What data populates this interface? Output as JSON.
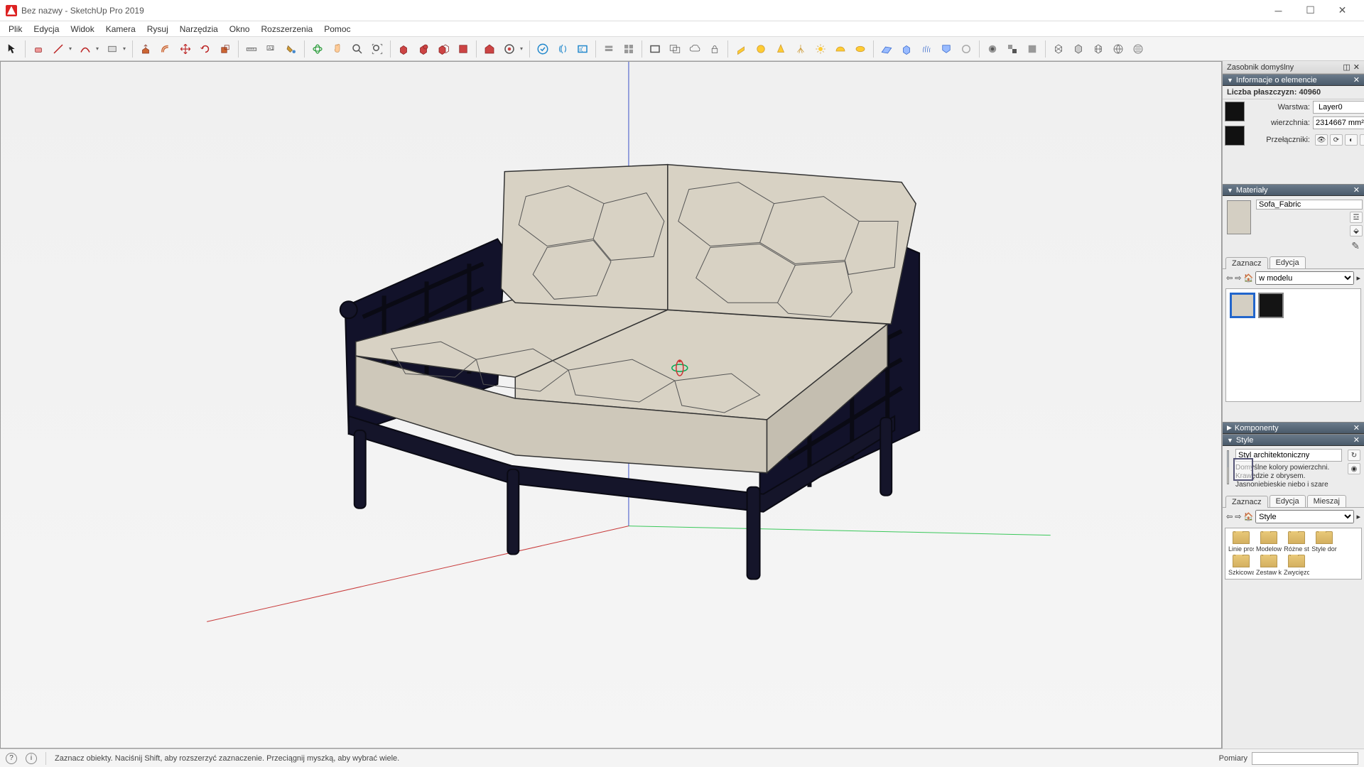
{
  "window": {
    "title": "Bez nazwy - SketchUp Pro 2019"
  },
  "menu": {
    "items": [
      "Plik",
      "Edycja",
      "Widok",
      "Kamera",
      "Rysuj",
      "Narzędzia",
      "Okno",
      "Rozszerzenia",
      "Pomoc"
    ]
  },
  "tray": {
    "title": "Zasobnik domyślny",
    "entity_info": {
      "title": "Informacje o elemencie",
      "faces_label": "Liczba płaszczyzn:",
      "faces_value": "40960",
      "layer_label": "Warstwa:",
      "layer_value": "Layer0",
      "area_label": "wierzchnia:",
      "area_value": "2314667 mm²",
      "toggles_label": "Przełączniki:"
    },
    "materials": {
      "title": "Materiały",
      "name": "Sofa_Fabric",
      "tab_select": "Zaznacz",
      "tab_edit": "Edycja",
      "scope": "w modelu",
      "swatches": [
        {
          "color": "#d4cfc3",
          "selected": true
        },
        {
          "color": "#141414",
          "selected": false
        }
      ]
    },
    "components": {
      "title": "Komponenty"
    },
    "styles": {
      "title": "Style",
      "name": "Styl architektoniczny",
      "desc": "Domyślne kolory powierzchni. Krawędzie z obrysem. Jasnoniebieskie niebo i szare",
      "tab_select": "Zaznacz",
      "tab_edit": "Edycja",
      "tab_mix": "Mieszaj",
      "scope": "Style",
      "folders": [
        "Linie pros",
        "Modelow",
        "Różne st",
        "Style dor",
        "Szkicowa",
        "Zestaw k",
        "Zwycięzc"
      ]
    }
  },
  "statusbar": {
    "hint": "Zaznacz obiekty. Naciśnij Shift, aby rozszerzyć zaznaczenie. Przeciągnij myszką, aby wybrać wiele.",
    "measure_label": "Pomiary"
  }
}
